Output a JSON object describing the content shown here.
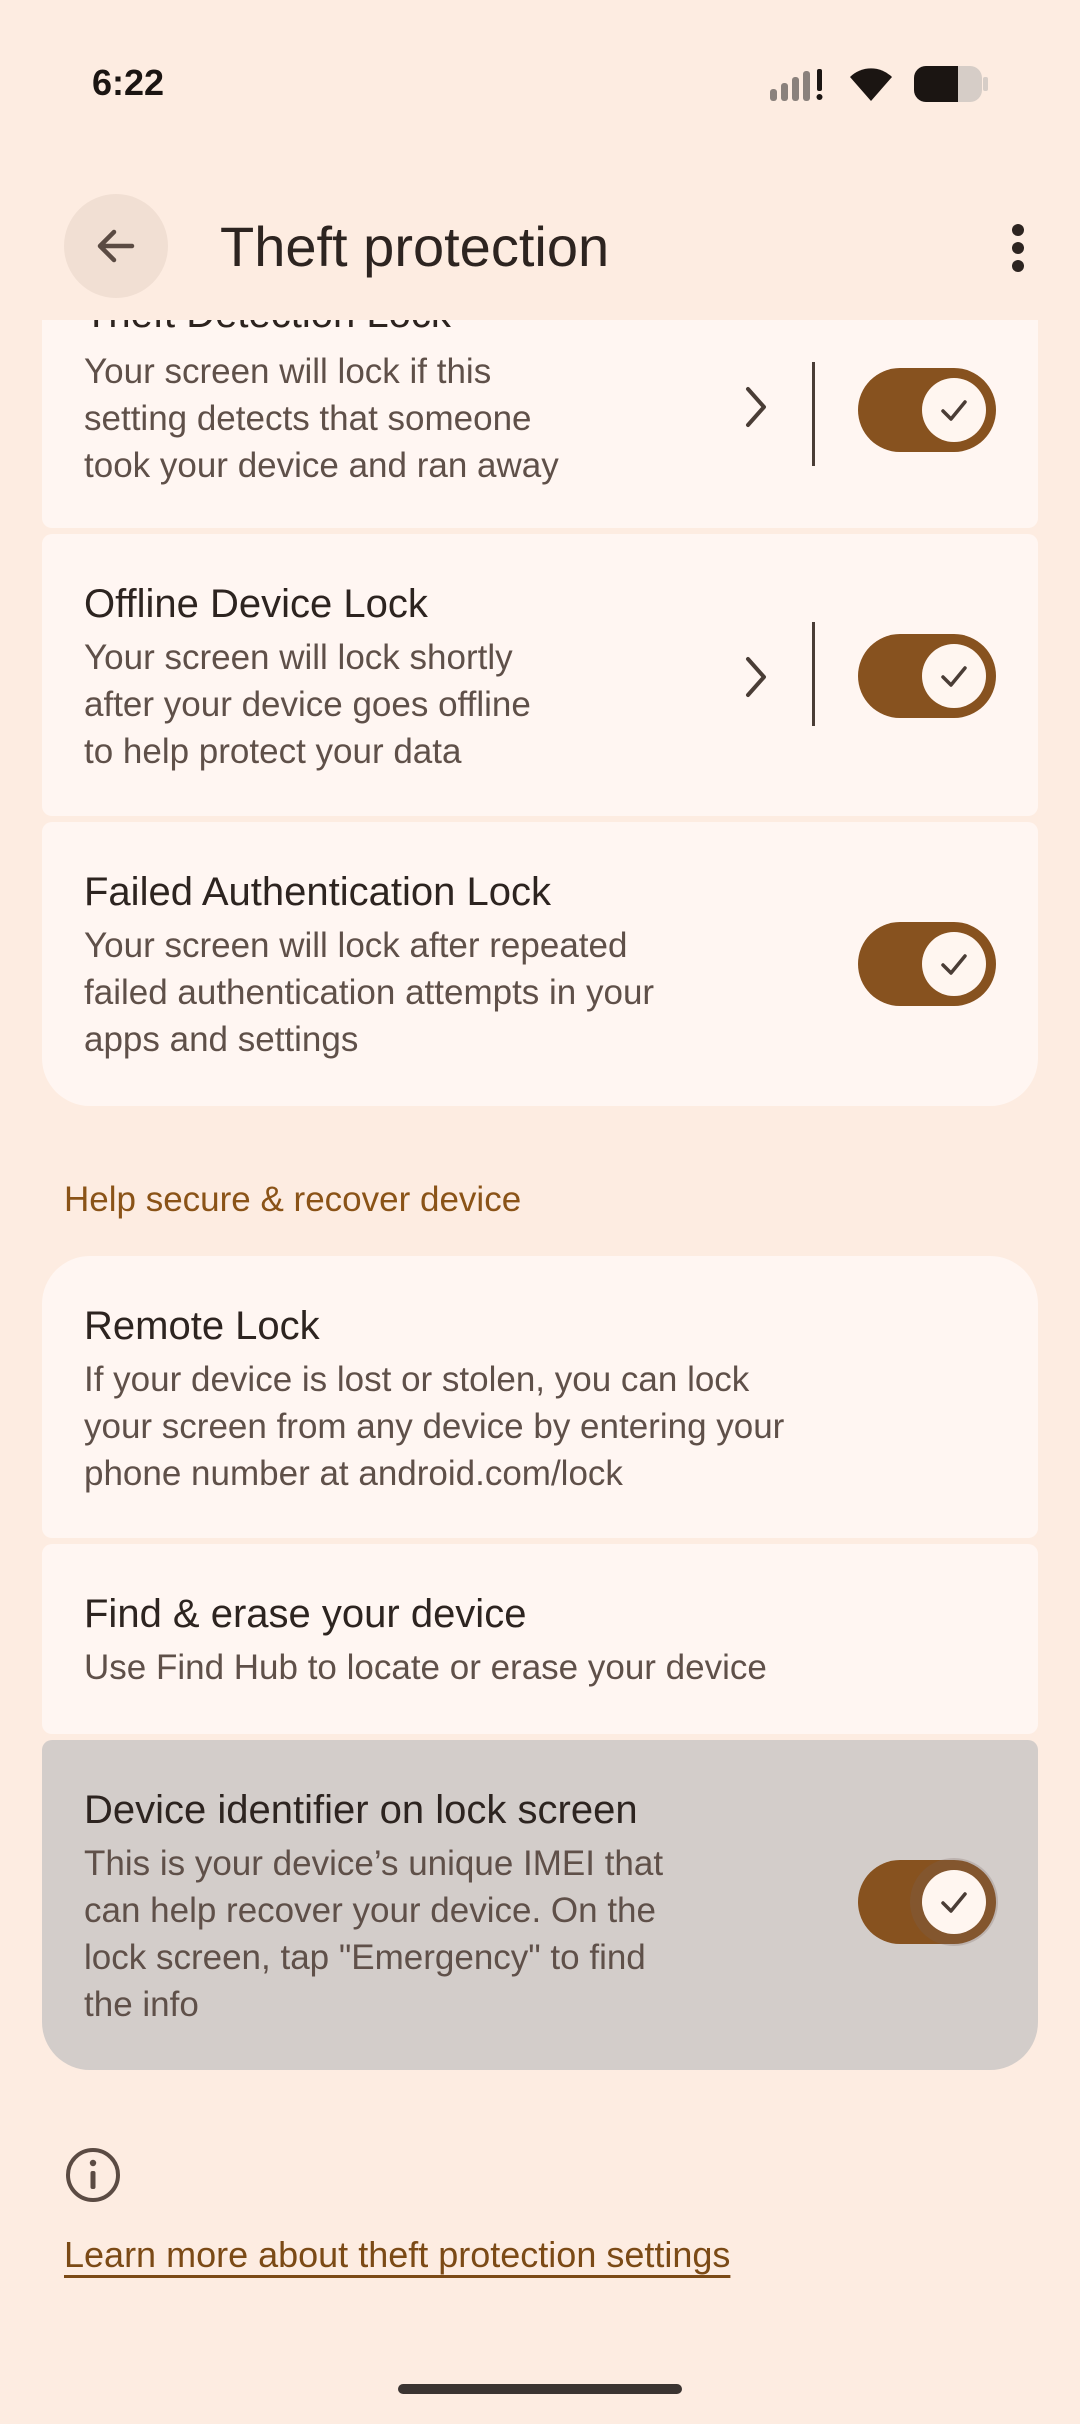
{
  "status_bar": {
    "time": "6:22"
  },
  "app_bar": {
    "title": "Theft protection"
  },
  "cards": {
    "theft_detection": {
      "title": "Theft Detection Lock",
      "summary_lines": [
        "Your screen will lock if this",
        "setting detects that someone",
        "took your device and ran away"
      ],
      "toggle_on": true
    },
    "offline_device": {
      "title": "Offline Device Lock",
      "summary_lines": [
        "Your screen will lock shortly",
        "after your device goes offline",
        "to help protect your data"
      ],
      "toggle_on": true
    },
    "failed_auth": {
      "title": "Failed Authentication Lock",
      "summary_lines": [
        "Your screen will lock after repeated",
        "failed authentication attempts in your",
        "apps and settings"
      ],
      "toggle_on": true
    },
    "remote_lock": {
      "title": "Remote Lock",
      "summary_lines": [
        "If your device is lost or stolen, you can lock",
        "your screen from any device by entering your",
        "phone number at android.com/lock"
      ]
    },
    "find_erase": {
      "title": "Find & erase your device",
      "summary_lines": [
        "Use Find Hub to locate or erase your device"
      ]
    },
    "device_identifier": {
      "title": "Device identifier on lock screen",
      "summary_lines": [
        "This is your device’s unique IMEI that",
        "can help recover your device. On the",
        "lock screen, tap \"Emergency\" to find",
        "the info"
      ],
      "toggle_on": true
    }
  },
  "section_header": "Help secure & recover device",
  "learn_more": "Learn more about theft protection settings",
  "colors": {
    "accent": "#87521f",
    "background": "#fdece1",
    "card": "#fff6f2",
    "section": "#8a5317"
  }
}
